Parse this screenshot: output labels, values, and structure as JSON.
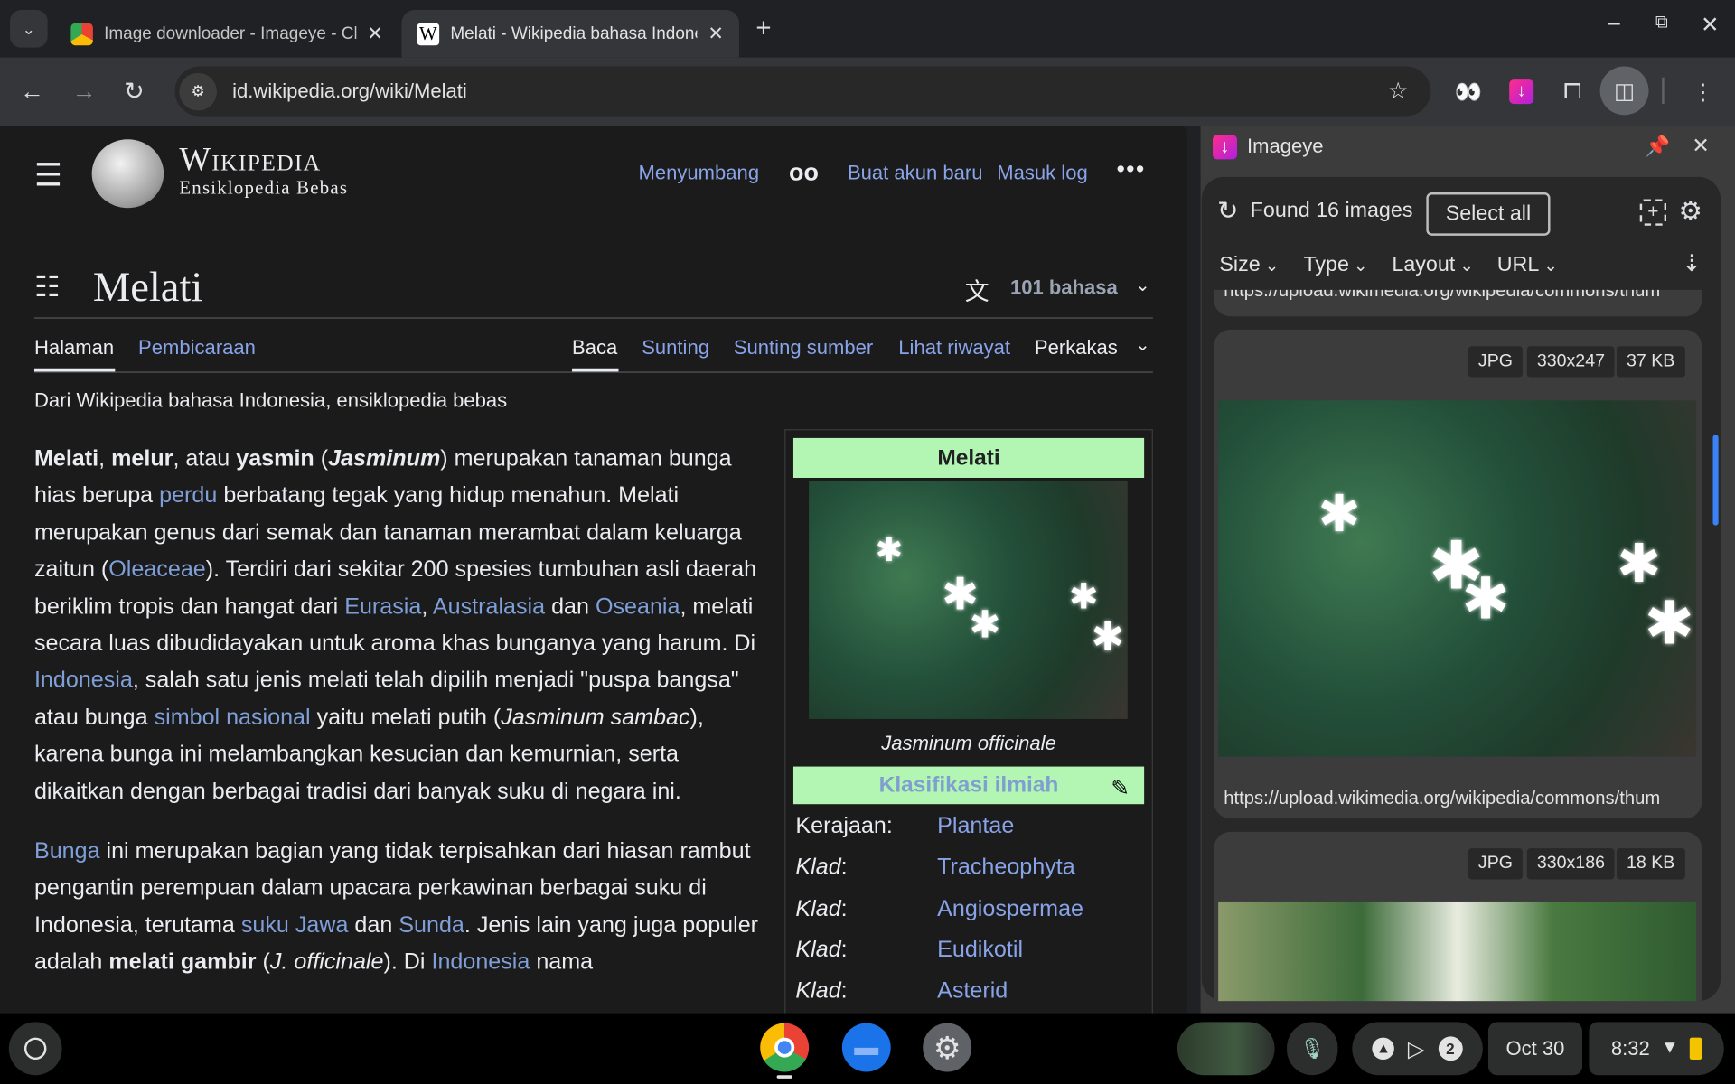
{
  "browser": {
    "tabs": [
      {
        "title": "Image downloader - Imageye - Chrome Web Store",
        "active": false
      },
      {
        "title": "Melati - Wikipedia bahasa Indonesia",
        "active": true
      }
    ],
    "url": "id.wikipedia.org/wiki/Melati"
  },
  "wiki": {
    "logo_title": "Wikipedia",
    "logo_subtitle": "Ensiklopedia Bebas",
    "header_links": [
      "Menyumbang",
      "Buat akun baru",
      "Masuk log"
    ],
    "page_title": "Melati",
    "languages": "101 bahasa",
    "tabs_left": [
      "Halaman",
      "Pembicaraan"
    ],
    "tabs_right": [
      "Baca",
      "Sunting",
      "Sunting sumber",
      "Lihat riwayat",
      "Perkakas"
    ],
    "tagline": "Dari Wikipedia bahasa Indonesia, ensiklopedia bebas",
    "paragraphs": [
      [
        {
          "t": "Melati",
          "s": "b"
        },
        {
          "t": ", "
        },
        {
          "t": "melur",
          "s": "b"
        },
        {
          "t": ", atau "
        },
        {
          "t": "yasmin",
          "s": "b"
        },
        {
          "t": " ("
        },
        {
          "t": "Jasminum",
          "s": "bi"
        },
        {
          "t": ") merupakan tanaman bunga hias berupa "
        },
        {
          "t": "perdu",
          "s": "a"
        },
        {
          "t": " berbatang tegak yang hidup menahun. Melati merupakan genus dari semak dan tanaman merambat dalam keluarga zaitun ("
        },
        {
          "t": "Oleaceae",
          "s": "a"
        },
        {
          "t": "). Terdiri dari sekitar 200 spesies tumbuhan asli daerah beriklim tropis dan hangat dari "
        },
        {
          "t": "Eurasia",
          "s": "a"
        },
        {
          "t": ", "
        },
        {
          "t": "Australasia",
          "s": "a"
        },
        {
          "t": " dan "
        },
        {
          "t": "Oseania",
          "s": "a"
        },
        {
          "t": ", melati secara luas dibudidayakan untuk aroma khas bunganya yang harum. Di "
        },
        {
          "t": "Indonesia",
          "s": "a"
        },
        {
          "t": ", salah satu jenis melati telah dipilih menjadi \"puspa bangsa\" atau bunga "
        },
        {
          "t": "simbol nasional",
          "s": "a"
        },
        {
          "t": " yaitu melati putih ("
        },
        {
          "t": "Jasminum sambac",
          "s": "i"
        },
        {
          "t": "), karena bunga ini melambangkan kesucian dan kemurnian, serta dikaitkan dengan berbagai tradisi dari banyak suku di negara ini."
        }
      ],
      [
        {
          "t": "Bunga",
          "s": "a"
        },
        {
          "t": " ini merupakan bagian yang tidak terpisahkan dari hiasan rambut pengantin perempuan dalam upacara perkawinan berbagai suku di Indonesia, terutama "
        },
        {
          "t": "suku Jawa",
          "s": "a"
        },
        {
          "t": " dan "
        },
        {
          "t": "Sunda",
          "s": "a"
        },
        {
          "t": ". Jenis lain yang juga populer adalah "
        },
        {
          "t": "melati gambir",
          "s": "b"
        },
        {
          "t": " ("
        },
        {
          "t": "J. officinale",
          "s": "i"
        },
        {
          "t": "). Di "
        },
        {
          "t": "Indonesia",
          "s": "a"
        },
        {
          "t": " nama"
        }
      ]
    ],
    "infobox": {
      "title": "Melati",
      "caption": "Jasminum officinale",
      "section": "Klasifikasi ilmiah",
      "rows": [
        {
          "k": "Kerajaan:",
          "v": "Plantae",
          "ki": false
        },
        {
          "k": "Klad",
          "v": "Tracheophyta",
          "ki": true
        },
        {
          "k": "Klad",
          "v": "Angiospermae",
          "ki": true
        },
        {
          "k": "Klad",
          "v": "Eudikotil",
          "ki": true
        },
        {
          "k": "Klad",
          "v": "Asterid",
          "ki": true
        }
      ]
    }
  },
  "imageye": {
    "title": "Imageye",
    "found": "Found 16 images",
    "select_all": "Select all",
    "filters": [
      "Size",
      "Type",
      "Layout",
      "URL"
    ],
    "partial_url": "https://upload.wikimedia.org/wikipedia/commons/thum",
    "images": [
      {
        "type": "JPG",
        "dims": "330x247",
        "size": "37 KB",
        "url": "https://upload.wikimedia.org/wikipedia/commons/thum"
      },
      {
        "type": "JPG",
        "dims": "330x186",
        "size": "18 KB"
      }
    ]
  },
  "shelf": {
    "notification_count": "2",
    "date": "Oct 30",
    "time": "8:32"
  },
  "colors": {
    "link": "#88a3e8",
    "infobox_header": "#b3f6b3",
    "imageye_brand": "#e0218a",
    "battery": "#f5c400"
  }
}
